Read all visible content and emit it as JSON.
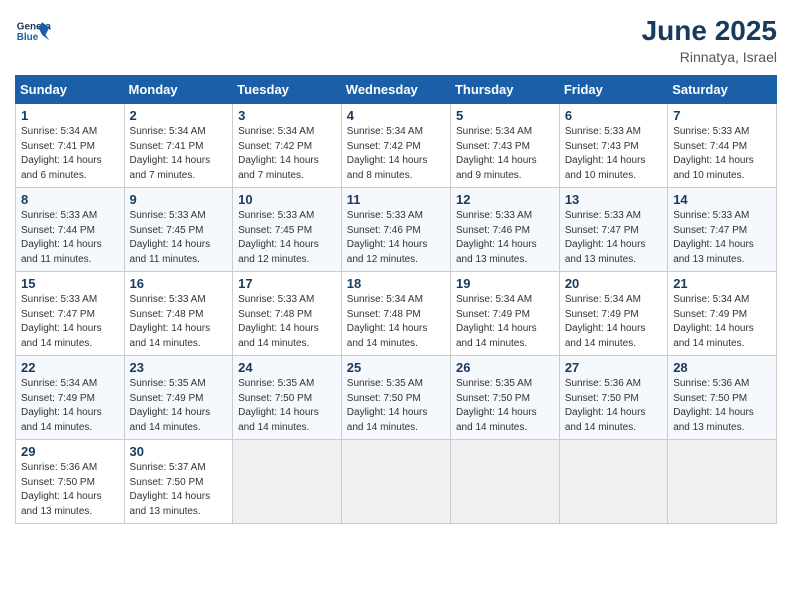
{
  "header": {
    "logo_line1": "General",
    "logo_line2": "Blue",
    "month": "June 2025",
    "location": "Rinnatya, Israel"
  },
  "days_of_week": [
    "Sunday",
    "Monday",
    "Tuesday",
    "Wednesday",
    "Thursday",
    "Friday",
    "Saturday"
  ],
  "weeks": [
    [
      {
        "day": "1",
        "info": "Sunrise: 5:34 AM\nSunset: 7:41 PM\nDaylight: 14 hours\nand 6 minutes."
      },
      {
        "day": "2",
        "info": "Sunrise: 5:34 AM\nSunset: 7:41 PM\nDaylight: 14 hours\nand 7 minutes."
      },
      {
        "day": "3",
        "info": "Sunrise: 5:34 AM\nSunset: 7:42 PM\nDaylight: 14 hours\nand 7 minutes."
      },
      {
        "day": "4",
        "info": "Sunrise: 5:34 AM\nSunset: 7:42 PM\nDaylight: 14 hours\nand 8 minutes."
      },
      {
        "day": "5",
        "info": "Sunrise: 5:34 AM\nSunset: 7:43 PM\nDaylight: 14 hours\nand 9 minutes."
      },
      {
        "day": "6",
        "info": "Sunrise: 5:33 AM\nSunset: 7:43 PM\nDaylight: 14 hours\nand 10 minutes."
      },
      {
        "day": "7",
        "info": "Sunrise: 5:33 AM\nSunset: 7:44 PM\nDaylight: 14 hours\nand 10 minutes."
      }
    ],
    [
      {
        "day": "8",
        "info": "Sunrise: 5:33 AM\nSunset: 7:44 PM\nDaylight: 14 hours\nand 11 minutes."
      },
      {
        "day": "9",
        "info": "Sunrise: 5:33 AM\nSunset: 7:45 PM\nDaylight: 14 hours\nand 11 minutes."
      },
      {
        "day": "10",
        "info": "Sunrise: 5:33 AM\nSunset: 7:45 PM\nDaylight: 14 hours\nand 12 minutes."
      },
      {
        "day": "11",
        "info": "Sunrise: 5:33 AM\nSunset: 7:46 PM\nDaylight: 14 hours\nand 12 minutes."
      },
      {
        "day": "12",
        "info": "Sunrise: 5:33 AM\nSunset: 7:46 PM\nDaylight: 14 hours\nand 13 minutes."
      },
      {
        "day": "13",
        "info": "Sunrise: 5:33 AM\nSunset: 7:47 PM\nDaylight: 14 hours\nand 13 minutes."
      },
      {
        "day": "14",
        "info": "Sunrise: 5:33 AM\nSunset: 7:47 PM\nDaylight: 14 hours\nand 13 minutes."
      }
    ],
    [
      {
        "day": "15",
        "info": "Sunrise: 5:33 AM\nSunset: 7:47 PM\nDaylight: 14 hours\nand 14 minutes."
      },
      {
        "day": "16",
        "info": "Sunrise: 5:33 AM\nSunset: 7:48 PM\nDaylight: 14 hours\nand 14 minutes."
      },
      {
        "day": "17",
        "info": "Sunrise: 5:33 AM\nSunset: 7:48 PM\nDaylight: 14 hours\nand 14 minutes."
      },
      {
        "day": "18",
        "info": "Sunrise: 5:34 AM\nSunset: 7:48 PM\nDaylight: 14 hours\nand 14 minutes."
      },
      {
        "day": "19",
        "info": "Sunrise: 5:34 AM\nSunset: 7:49 PM\nDaylight: 14 hours\nand 14 minutes."
      },
      {
        "day": "20",
        "info": "Sunrise: 5:34 AM\nSunset: 7:49 PM\nDaylight: 14 hours\nand 14 minutes."
      },
      {
        "day": "21",
        "info": "Sunrise: 5:34 AM\nSunset: 7:49 PM\nDaylight: 14 hours\nand 14 minutes."
      }
    ],
    [
      {
        "day": "22",
        "info": "Sunrise: 5:34 AM\nSunset: 7:49 PM\nDaylight: 14 hours\nand 14 minutes."
      },
      {
        "day": "23",
        "info": "Sunrise: 5:35 AM\nSunset: 7:49 PM\nDaylight: 14 hours\nand 14 minutes."
      },
      {
        "day": "24",
        "info": "Sunrise: 5:35 AM\nSunset: 7:50 PM\nDaylight: 14 hours\nand 14 minutes."
      },
      {
        "day": "25",
        "info": "Sunrise: 5:35 AM\nSunset: 7:50 PM\nDaylight: 14 hours\nand 14 minutes."
      },
      {
        "day": "26",
        "info": "Sunrise: 5:35 AM\nSunset: 7:50 PM\nDaylight: 14 hours\nand 14 minutes."
      },
      {
        "day": "27",
        "info": "Sunrise: 5:36 AM\nSunset: 7:50 PM\nDaylight: 14 hours\nand 14 minutes."
      },
      {
        "day": "28",
        "info": "Sunrise: 5:36 AM\nSunset: 7:50 PM\nDaylight: 14 hours\nand 13 minutes."
      }
    ],
    [
      {
        "day": "29",
        "info": "Sunrise: 5:36 AM\nSunset: 7:50 PM\nDaylight: 14 hours\nand 13 minutes."
      },
      {
        "day": "30",
        "info": "Sunrise: 5:37 AM\nSunset: 7:50 PM\nDaylight: 14 hours\nand 13 minutes."
      },
      null,
      null,
      null,
      null,
      null
    ]
  ]
}
